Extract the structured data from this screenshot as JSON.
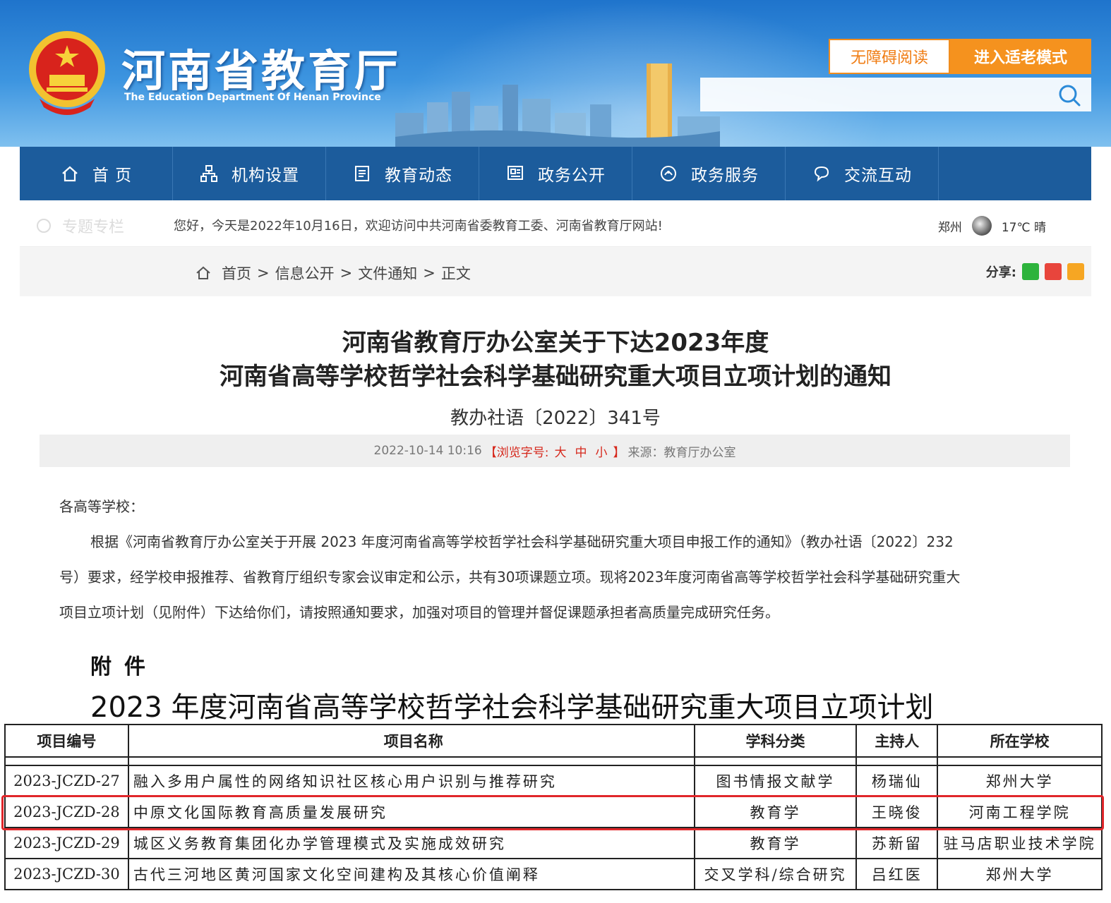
{
  "header": {
    "site_title": "河南省教育厅",
    "site_subtitle": "The Education Department Of Henan Province",
    "accessibility_label": "无障碍阅读",
    "elder_mode_label": "进入适老模式",
    "search_placeholder": ""
  },
  "nav": {
    "items": [
      {
        "label": "首 页",
        "icon": "home-icon"
      },
      {
        "label": "机构设置",
        "icon": "org-chart-icon"
      },
      {
        "label": "教育动态",
        "icon": "news-icon"
      },
      {
        "label": "政务公开",
        "icon": "document-icon"
      },
      {
        "label": "政务服务",
        "icon": "service-icon"
      },
      {
        "label": "交流互动",
        "icon": "chat-icon"
      }
    ]
  },
  "notice": {
    "topic_entry": "专题专栏",
    "welcome": "您好，今天是2022年10月16日，欢迎访问中共河南省委教育工委、河南省教育厅网站!",
    "city": "郑州",
    "weather": "17℃ 晴"
  },
  "breadcrumb": {
    "items": [
      "首页",
      "信息公开",
      "文件通知"
    ],
    "separator": ">",
    "current": "正文",
    "share_label": "分享:"
  },
  "article": {
    "title_line1": "河南省教育厅办公室关于下达2023年度",
    "title_line2": "河南省高等学校哲学社会科学基础研究重大项目立项计划的通知",
    "doc_number": "教办社语〔2022〕341号",
    "datetime": "2022-10-14 10:16",
    "font_size_prefix": "【浏览字号:",
    "font_size_large": "大",
    "font_size_medium": "中",
    "font_size_small": "小",
    "font_size_suffix": "】",
    "source": "来源：教育厅办公室",
    "salutation": "各高等学校：",
    "body_line1": "根据《河南省教育厅办公室关于开展 2023 年度河南省高等学校哲学社会科学基础研究重大项目申报工作的通知》（教办社语〔2022〕232",
    "body_line2": "号）要求，经学校申报推荐、省教育厅组织专家会议审定和公示，共有30项课题立项。现将2023年度河南省高等学校哲学社会科学基础研究重大",
    "body_line3": "项目立项计划（见附件）下达给你们，请按照通知要求，加强对项目的管理并督促课题承担者高质量完成研究任务。"
  },
  "attachment": {
    "label": "附件",
    "title": "2023 年度河南省高等学校哲学社会科学基础研究重大项目立项计划",
    "columns": [
      "项目编号",
      "项目名称",
      "学科分类",
      "主持人",
      "所在学校"
    ],
    "rows": [
      [
        "2023-JCZD-27",
        "融入多用户属性的网络知识社区核心用户识别与推荐研究",
        "图书情报文献学",
        "杨瑞仙",
        "郑州大学"
      ],
      [
        "2023-JCZD-28",
        "中原文化国际教育高质量发展研究",
        "教育学",
        "王晓俊",
        "河南工程学院"
      ],
      [
        "2023-JCZD-29",
        "城区义务教育集团化办学管理模式及实施成效研究",
        "教育学",
        "苏新留",
        "驻马店职业技术学院"
      ],
      [
        "2023-JCZD-30",
        "古代三河地区黄河国家文化空间建构及其核心价值阐释",
        "交叉学科/综合研究",
        "吕红医",
        "郑州大学"
      ]
    ]
  }
}
